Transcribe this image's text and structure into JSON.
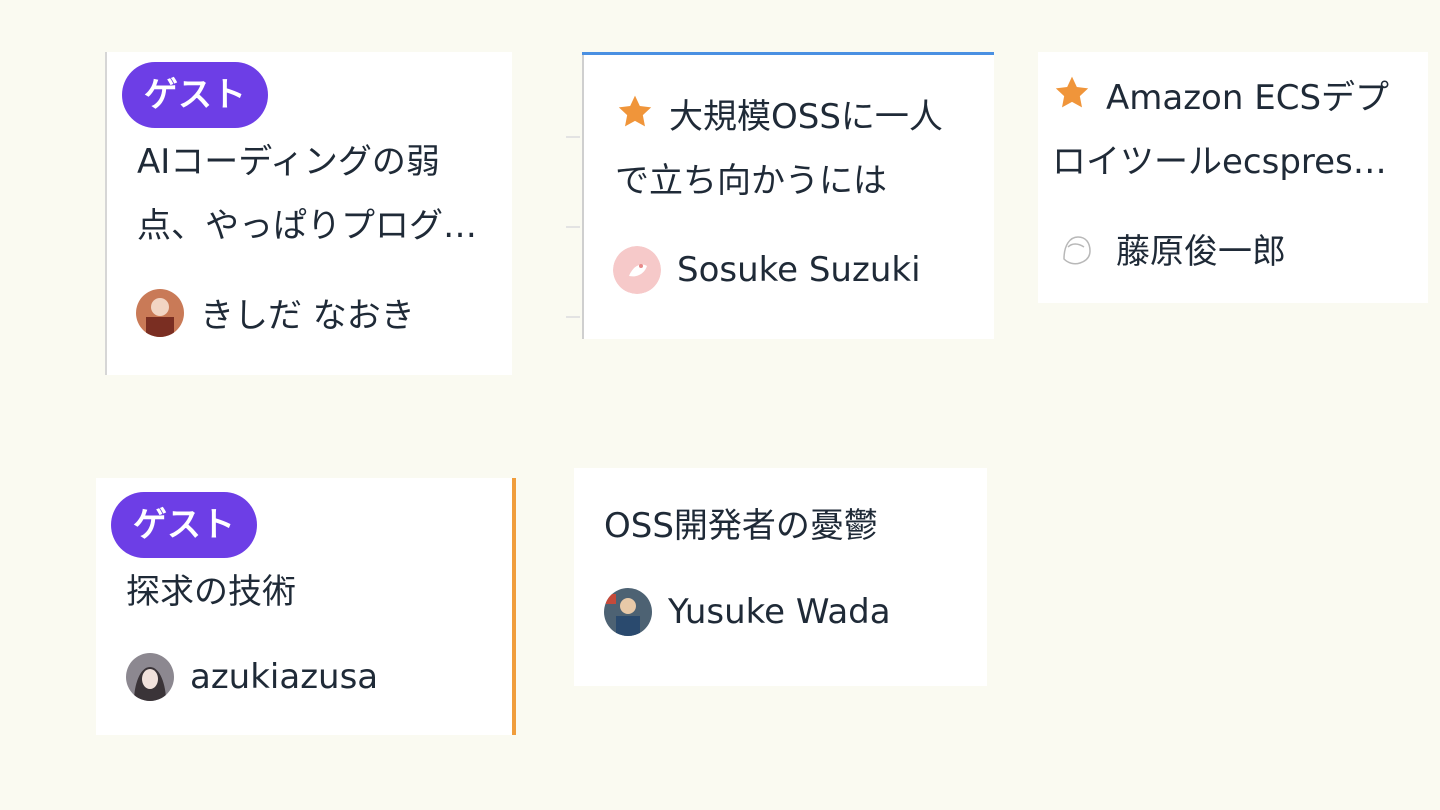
{
  "cards": [
    {
      "badge": "ゲスト",
      "title": "AIコーディングの弱点、やっぱりプログラミングの基礎が大事",
      "author": "きしだ なおき",
      "avatar_color": "#b85a43"
    },
    {
      "starred": true,
      "title": "大規模OSSに一人で立ち向かうには",
      "author": "Sosuke Suzuki",
      "avatar_color": "#f3b6b6",
      "accent_color": "#4a90e2"
    },
    {
      "starred": true,
      "title": "Amazon ECSデプロイツールecspressoの開発を支える",
      "author": "藤原俊一郎",
      "avatar_color": "#ffffff"
    },
    {
      "badge": "ゲスト",
      "title": "探求の技術",
      "author": "azukiazusa",
      "avatar_color": "#5a5560",
      "accent_color": "#f09d3c"
    },
    {
      "title": "OSS開発者の憂鬱",
      "author": "Yusuke Wada",
      "avatar_color": "#3c4d5e"
    }
  ],
  "colors": {
    "background": "#fafaf1",
    "badge": "#6d3ee6",
    "star": "#f0953a",
    "text": "#1f2a37"
  },
  "icons": {
    "star": "star-icon",
    "avatar": "avatar"
  }
}
